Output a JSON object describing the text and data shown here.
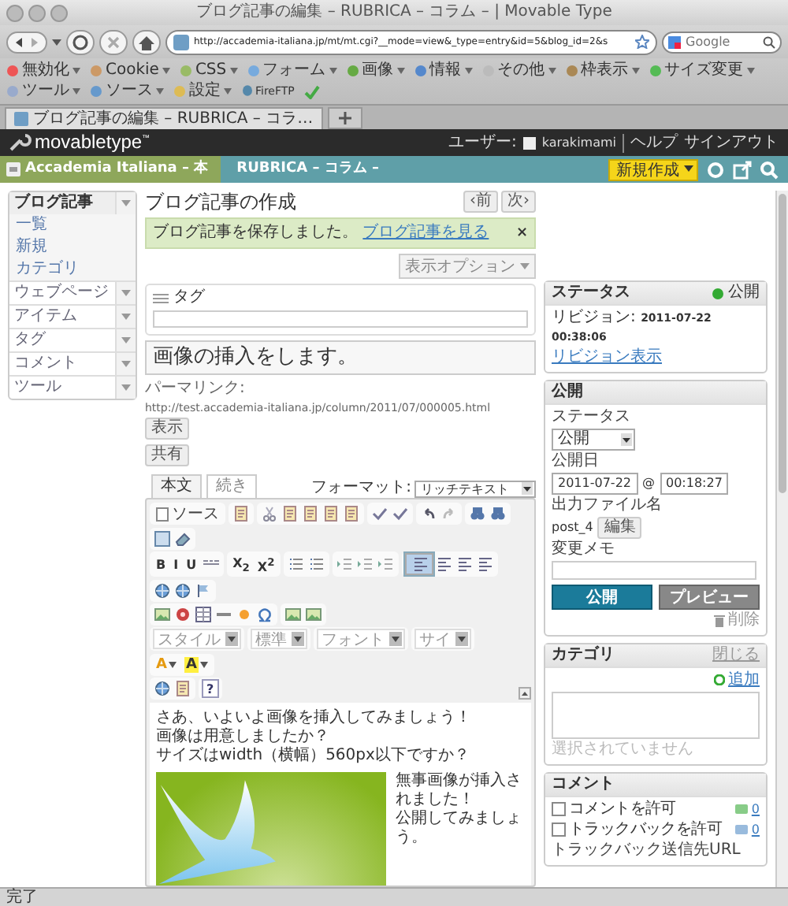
{
  "window": {
    "title": "ブログ記事の編集 – RUBRICA – コラム – | Movable Type"
  },
  "navbar": {
    "url": "http://accademia-italiana.jp/mt/mt.cgi?__mode=view&_type=entry&id=5&blog_id=2&s"
  },
  "search": {
    "placeholder": "Google"
  },
  "bookmarks": [
    {
      "label": "無効化"
    },
    {
      "label": "Cookie"
    },
    {
      "label": "CSS"
    },
    {
      "label": "フォーム"
    },
    {
      "label": "画像"
    },
    {
      "label": "情報"
    },
    {
      "label": "その他"
    },
    {
      "label": "枠表示"
    },
    {
      "label": "サイズ変更"
    },
    {
      "label": "ツール"
    },
    {
      "label": "ソース"
    },
    {
      "label": "設定"
    }
  ],
  "fireftp": "FireFTP",
  "tabs": [
    {
      "label": "ブログ記事の編集 – RUBRICA – コラ…",
      "selected": true
    }
  ],
  "app_header": {
    "logo": "movabletype",
    "trademark": "™",
    "user_label": "ユーザー:",
    "username": "karakimami",
    "links": [
      "ヘルプ",
      "サインアウト"
    ]
  },
  "blog_bar": {
    "website": "Accademia Italiana – 本",
    "blog": "RUBRICA – コラム –",
    "new_button": "新規作成"
  },
  "sidebar": [
    {
      "label": "ブログ記事",
      "expanded": true,
      "children": [
        {
          "label": "一覧"
        },
        {
          "label": "新規"
        },
        {
          "label": "カテゴリ"
        }
      ]
    },
    {
      "label": "ウェブページ",
      "expanded": false
    },
    {
      "label": "アイテム",
      "expanded": false
    },
    {
      "label": "タグ",
      "expanded": false
    },
    {
      "label": "コメント",
      "expanded": false
    },
    {
      "label": "ツール",
      "expanded": false
    }
  ],
  "page": {
    "heading": "ブログ記事の作成",
    "prev": "‹前",
    "next": "次›",
    "message": {
      "text": "ブログ記事を保存しました。",
      "link": "ブログ記事を見る",
      "close": "×"
    },
    "display_options": "表示オプション"
  },
  "tags_panel": {
    "title": "タグ"
  },
  "title_field": {
    "value": "画像の挿入をします。"
  },
  "permalink": {
    "label": "パーマリンク:",
    "url": "http://test.accademia-italiana.jp/column/2011/07/000005.html",
    "view_button": "表示",
    "share_button": "共有"
  },
  "editor": {
    "tabs": [
      {
        "label": "本文",
        "selected": true
      },
      {
        "label": "続き",
        "selected": false
      }
    ],
    "format_label": "フォーマット:",
    "format_value": "リッチテキスト",
    "toolbar": [
      [
        [
          {
            "kind": "source",
            "label": "ソース"
          }
        ],
        [
          {
            "kind": "icon"
          }
        ],
        [
          {
            "kind": "icon"
          },
          {
            "kind": "icon"
          },
          {
            "kind": "icon"
          },
          {
            "kind": "icon"
          },
          {
            "kind": "icon"
          }
        ],
        [
          {
            "kind": "icon"
          },
          {
            "kind": "icon"
          }
        ],
        [
          {
            "kind": "icon"
          },
          {
            "kind": "icon"
          }
        ],
        [
          {
            "kind": "icon"
          },
          {
            "kind": "icon"
          }
        ],
        [
          {
            "kind": "icon"
          },
          {
            "kind": "icon"
          }
        ]
      ],
      [
        [
          {
            "kind": "text",
            "label": "B"
          },
          {
            "kind": "text",
            "label": "I"
          },
          {
            "kind": "text",
            "label": "U"
          },
          {
            "kind": "icon"
          }
        ],
        [
          {
            "kind": "text",
            "label": "X$_{2}$"
          },
          {
            "kind": "text",
            "label": "X$^{2}$"
          }
        ],
        [
          {
            "kind": "icon"
          },
          {
            "kind": "icon"
          }
        ],
        [
          {
            "kind": "icon"
          },
          {
            "kind": "icon"
          },
          {
            "kind": "icon"
          }
        ],
        [
          {
            "kind": "icon",
            "selected": true
          },
          {
            "kind": "icon",
            "selected": false
          },
          {
            "kind": "icon",
            "selected": false
          },
          {
            "kind": "icon",
            "selected": false
          }
        ],
        [
          {
            "kind": "icon"
          },
          {
            "kind": "icon"
          },
          {
            "kind": "icon"
          }
        ]
      ],
      [
        [
          {
            "kind": "icon"
          },
          {
            "kind": "icon"
          },
          {
            "kind": "icon"
          },
          {
            "kind": "icon"
          },
          {
            "kind": "icon"
          },
          {
            "kind": "icon"
          }
        ],
        [
          {
            "kind": "icon"
          },
          {
            "kind": "icon"
          }
        ]
      ],
      [
        [
          {
            "kind": "select",
            "label": "スタイル"
          }
        ],
        [
          {
            "kind": "select",
            "label": "標準"
          }
        ],
        [
          {
            "kind": "select",
            "label": "フォント"
          }
        ],
        [
          {
            "kind": "select",
            "label": "サイ"
          }
        ],
        [
          {
            "kind": "forecolor",
            "label": "A"
          },
          {
            "kind": "backcolor",
            "label": "A"
          }
        ]
      ],
      [
        [
          {
            "kind": "icon"
          },
          {
            "kind": "icon"
          }
        ],
        [
          {
            "kind": "help",
            "label": "?"
          }
        ]
      ]
    ],
    "body": [
      "さあ、いよいよ画像を挿入してみましょう！",
      "画像は用意しましたか？",
      "サイズはwidth（横幅）560px以下ですか？"
    ],
    "image": {
      "kind": "picture"
    },
    "side_text": [
      "無事画像が挿入されました！",
      "公開してみましょう。"
    ]
  },
  "status_panel": {
    "title": "ステータス",
    "status": "公開",
    "revision_label": "リビジョン:",
    "revision": "2011-07-22 00:38:06",
    "revision_link": "リビジョン表示"
  },
  "publish_panel": {
    "title": "公開",
    "status_label": "ステータス",
    "status_value": "公開",
    "date_label": "公開日",
    "date": "2011-07-22",
    "at": "@",
    "time": "00:18:27",
    "filename_label": "出力ファイル名",
    "filename": "post_4",
    "edit_button": "編集",
    "memo_label": "変更メモ",
    "publish_button": "公開",
    "preview_button": "プレビュー",
    "delete_link": "削除"
  },
  "category_panel": {
    "title": "カテゴリ",
    "close_link": "閉じる",
    "add_link": "追加",
    "empty": "選択されていません"
  },
  "comment_panel": {
    "title": "コメント",
    "options": [
      {
        "label": "コメントを許可",
        "checked": false,
        "count": "0"
      },
      {
        "label": "トラックバックを許可",
        "checked": false,
        "count": "0"
      }
    ],
    "trackback_label": "トラックバック送信先URL"
  },
  "status_bar": "完了"
}
